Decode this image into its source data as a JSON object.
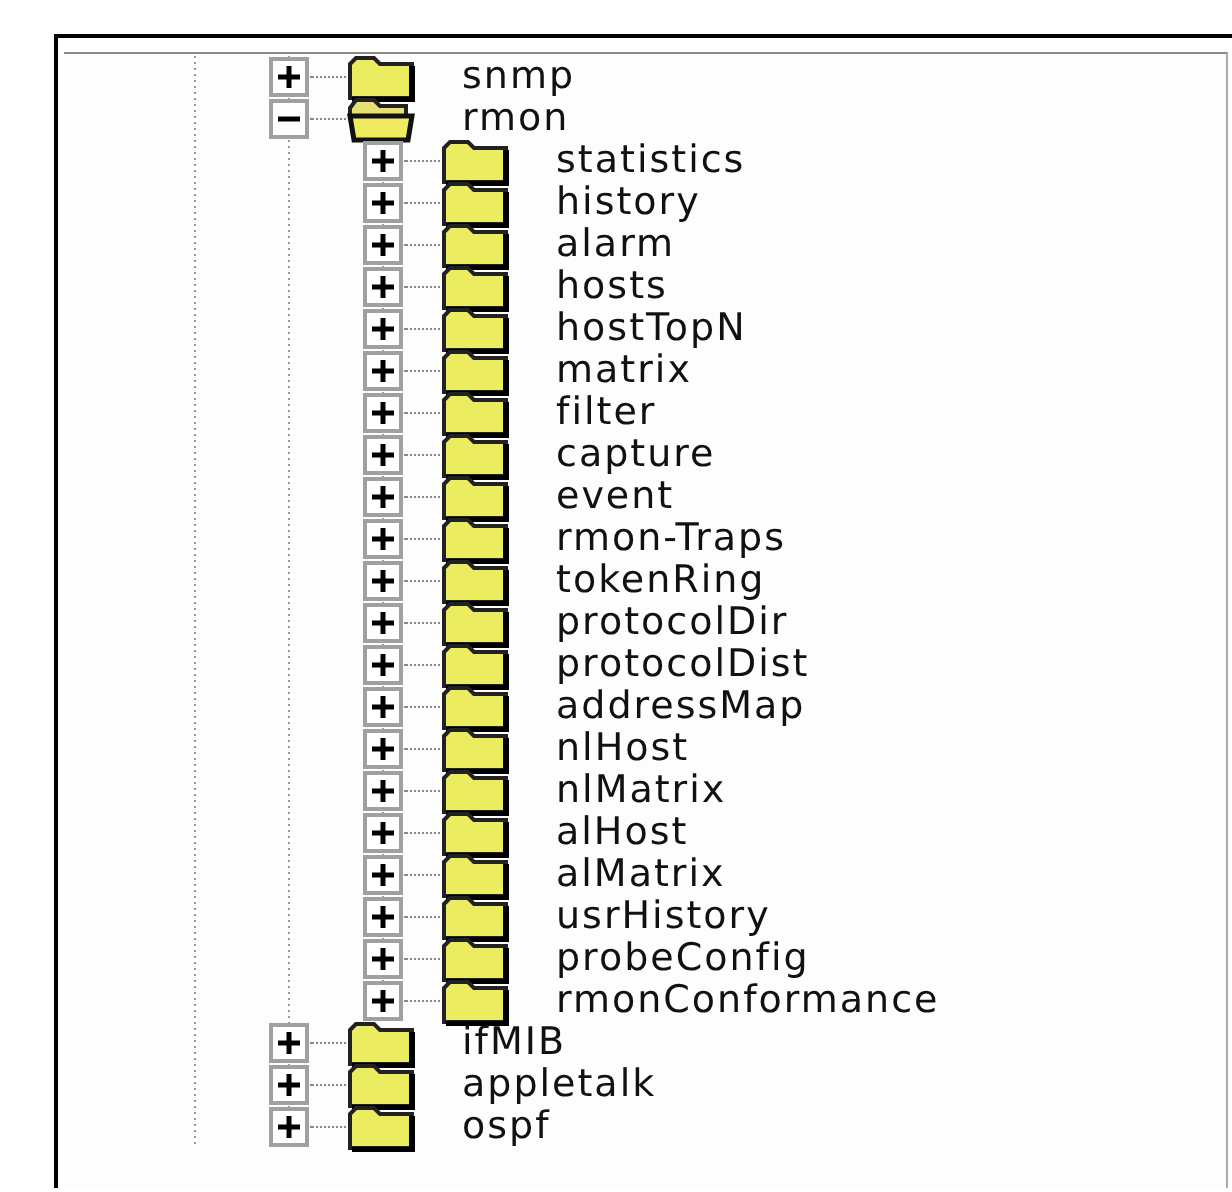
{
  "tree": {
    "items": [
      {
        "label": "snmp",
        "expanded": false
      },
      {
        "label": "rmon",
        "expanded": true,
        "children": [
          {
            "label": "statistics",
            "expanded": false
          },
          {
            "label": "history",
            "expanded": false
          },
          {
            "label": "alarm",
            "expanded": false
          },
          {
            "label": "hosts",
            "expanded": false
          },
          {
            "label": "hostTopN",
            "expanded": false
          },
          {
            "label": "matrix",
            "expanded": false
          },
          {
            "label": "filter",
            "expanded": false
          },
          {
            "label": "capture",
            "expanded": false
          },
          {
            "label": "event",
            "expanded": false
          },
          {
            "label": "rmon-Traps",
            "expanded": false
          },
          {
            "label": "tokenRing",
            "expanded": false
          },
          {
            "label": "protocolDir",
            "expanded": false
          },
          {
            "label": "protocolDist",
            "expanded": false
          },
          {
            "label": "addressMap",
            "expanded": false
          },
          {
            "label": "nlHost",
            "expanded": false
          },
          {
            "label": "nlMatrix",
            "expanded": false
          },
          {
            "label": "alHost",
            "expanded": false
          },
          {
            "label": "alMatrix",
            "expanded": false
          },
          {
            "label": "usrHistory",
            "expanded": false
          },
          {
            "label": "probeConfig",
            "expanded": false
          },
          {
            "label": "rmonConformance",
            "expanded": false
          }
        ]
      },
      {
        "label": "ifMIB",
        "expanded": false
      },
      {
        "label": "appletalk",
        "expanded": false
      },
      {
        "label": "ospf",
        "expanded": false
      }
    ]
  }
}
